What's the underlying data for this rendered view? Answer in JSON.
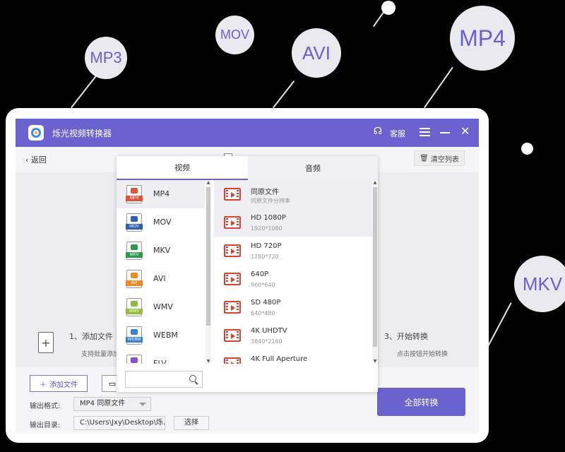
{
  "bubbles": {
    "mp3": "MP3",
    "mov": "MOV",
    "avi": "AVI",
    "mp4": "MP4",
    "mkv": "MKV"
  },
  "app": {
    "title": "烁光视频转换器",
    "service": "客服"
  },
  "toolbar": {
    "back": "返回",
    "clear_list": "清空列表"
  },
  "steps": {
    "step1_title": "1、添加文件",
    "step1_sub": "支持批量添加",
    "step3_title": "3、开始转换",
    "step3_sub": "点击按钮开始转换"
  },
  "bottom": {
    "add_file": "添加文件",
    "output_format_label": "输出格式:",
    "output_format_value": "MP4 同原文件",
    "output_dir_label": "输出目录:",
    "output_dir_value": "C:\\Users\\Jxy\\Desktop\\烁...",
    "choose": "选择",
    "convert_all": "全部转换"
  },
  "popup": {
    "tabs": [
      "视频",
      "音频"
    ],
    "formats": [
      {
        "name": "MP4",
        "color": "#e0533b"
      },
      {
        "name": "MOV",
        "color": "#2f5fb3"
      },
      {
        "name": "MKV",
        "color": "#2f9a4a"
      },
      {
        "name": "AVI",
        "color": "#f08a24"
      },
      {
        "name": "WMV",
        "color": "#8fbf3a"
      },
      {
        "name": "WEBM",
        "color": "#3b7fd6"
      },
      {
        "name": "FLV",
        "color": "#8a4fd0"
      }
    ],
    "resolutions": [
      {
        "name": "同原文件",
        "sub": "同原文件分辨率"
      },
      {
        "name": "HD 1080P",
        "sub": "1920*1080"
      },
      {
        "name": "HD 720P",
        "sub": "1280*720"
      },
      {
        "name": "640P",
        "sub": "960*640"
      },
      {
        "name": "SD 480P",
        "sub": "640*480"
      },
      {
        "name": "4K UHDTV",
        "sub": "3840*2160"
      },
      {
        "name": "4K Full Aperture",
        "sub": ""
      }
    ],
    "search_placeholder": ""
  }
}
